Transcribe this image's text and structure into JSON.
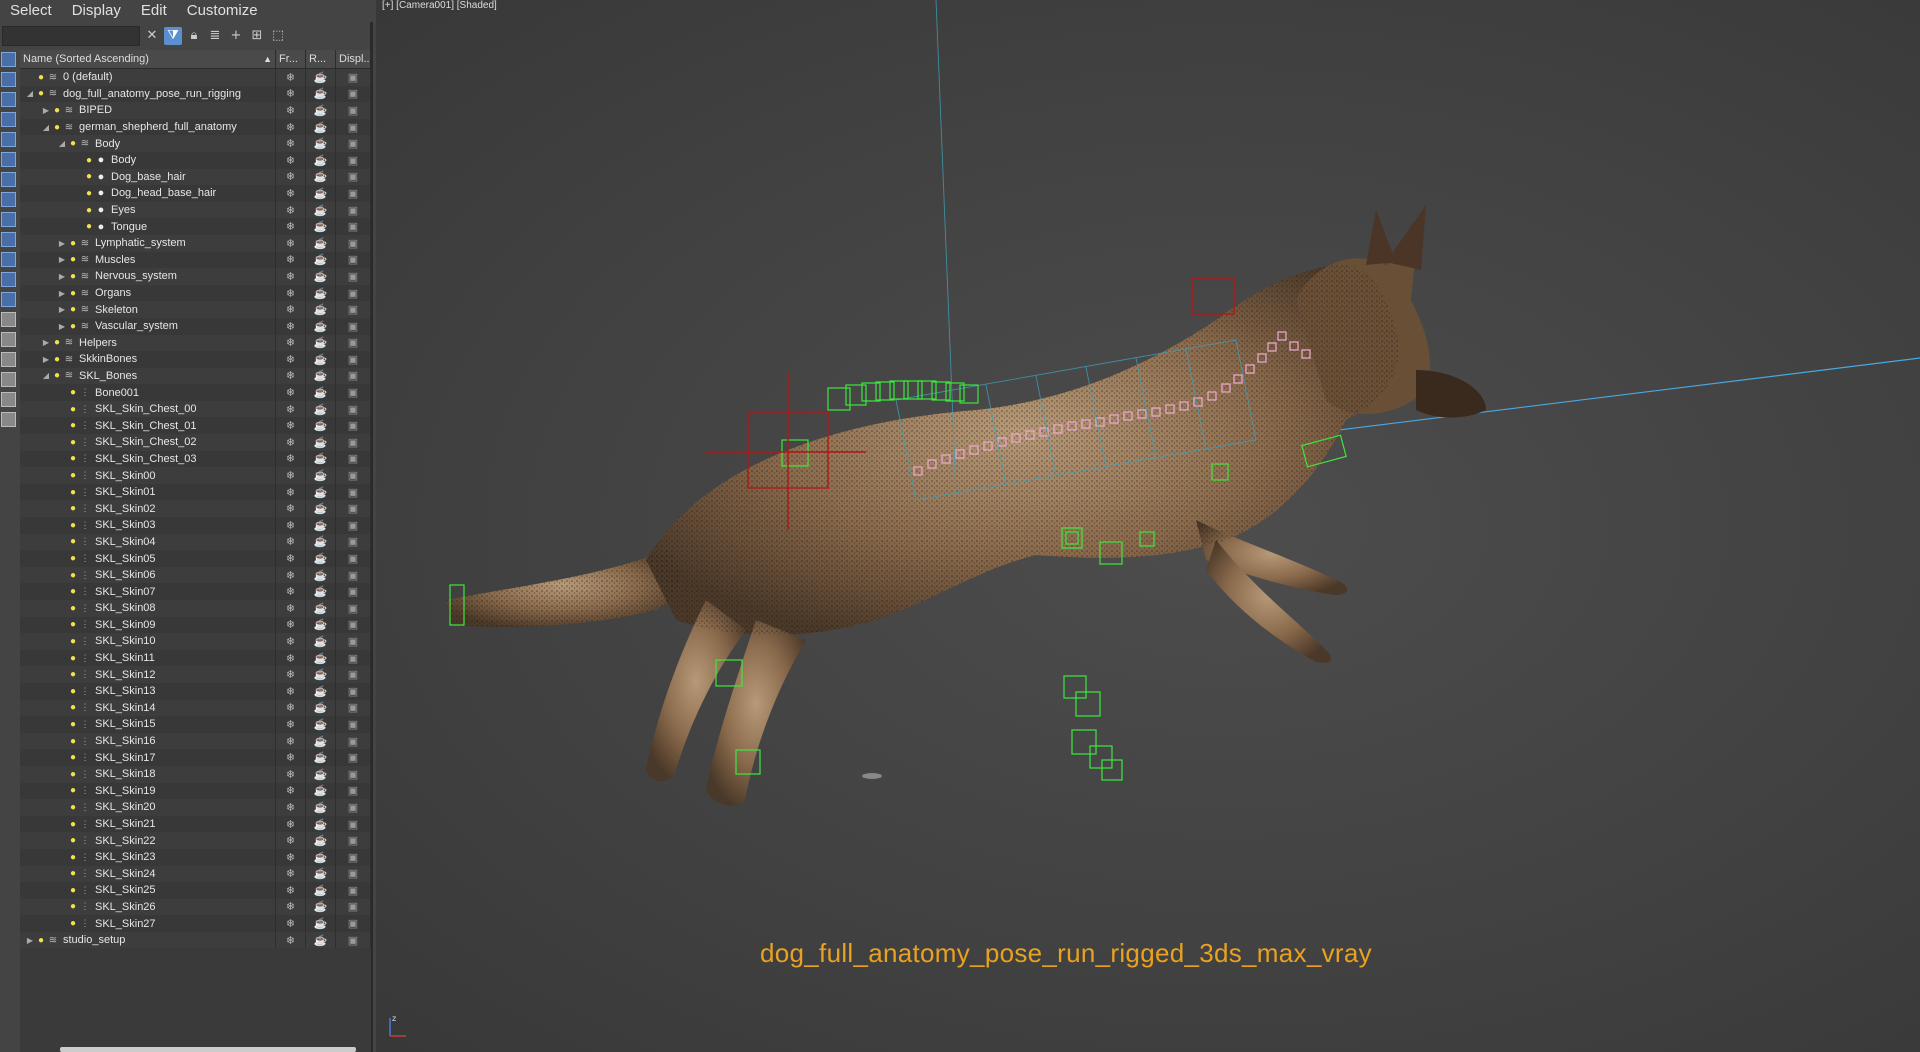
{
  "menu": {
    "items": [
      "Select",
      "Display",
      "Edit",
      "Customize"
    ]
  },
  "toolbar": {
    "search_value": "",
    "buttons": [
      "close-icon",
      "filter-icon",
      "lock-icon",
      "layer-icon",
      "add-icon",
      "hierarchy-icon",
      "select-icon"
    ]
  },
  "explorer": {
    "columns": {
      "name": "Name (Sorted Ascending)",
      "frozen": "Fr...",
      "render": "R...",
      "display": "Displ..."
    },
    "rows": [
      {
        "label": "0 (default)",
        "indent": 0,
        "kind": "layer",
        "expander": ""
      },
      {
        "label": "dog_full_anatomy_pose_run_rigging",
        "indent": 0,
        "kind": "layer",
        "expander": "open"
      },
      {
        "label": "BIPED",
        "indent": 1,
        "kind": "layer",
        "expander": "closed"
      },
      {
        "label": "german_shepherd_full_anatomy",
        "indent": 1,
        "kind": "layer",
        "expander": "open"
      },
      {
        "label": "Body",
        "indent": 2,
        "kind": "layer",
        "expander": "open"
      },
      {
        "label": "Body",
        "indent": 3,
        "kind": "object",
        "expander": ""
      },
      {
        "label": "Dog_base_hair",
        "indent": 3,
        "kind": "object",
        "expander": ""
      },
      {
        "label": "Dog_head_base_hair",
        "indent": 3,
        "kind": "object",
        "expander": ""
      },
      {
        "label": "Eyes",
        "indent": 3,
        "kind": "object",
        "expander": ""
      },
      {
        "label": "Tongue",
        "indent": 3,
        "kind": "object",
        "expander": ""
      },
      {
        "label": "Lymphatic_system",
        "indent": 2,
        "kind": "layer",
        "expander": "closed"
      },
      {
        "label": "Muscles",
        "indent": 2,
        "kind": "layer",
        "expander": "closed"
      },
      {
        "label": "Nervous_system",
        "indent": 2,
        "kind": "layer",
        "expander": "closed"
      },
      {
        "label": "Organs",
        "indent": 2,
        "kind": "layer",
        "expander": "closed"
      },
      {
        "label": "Skeleton",
        "indent": 2,
        "kind": "layer",
        "expander": "closed"
      },
      {
        "label": "Vascular_system",
        "indent": 2,
        "kind": "layer",
        "expander": "closed"
      },
      {
        "label": "Helpers",
        "indent": 1,
        "kind": "layer",
        "expander": "closed"
      },
      {
        "label": "SkkinBones",
        "indent": 1,
        "kind": "layer",
        "expander": "closed"
      },
      {
        "label": "SKL_Bones",
        "indent": 1,
        "kind": "layer",
        "expander": "open"
      },
      {
        "label": "Bone001",
        "indent": 2,
        "kind": "bone",
        "expander": ""
      },
      {
        "label": "SKL_Skin_Chest_00",
        "indent": 2,
        "kind": "bone",
        "expander": ""
      },
      {
        "label": "SKL_Skin_Chest_01",
        "indent": 2,
        "kind": "bone",
        "expander": ""
      },
      {
        "label": "SKL_Skin_Chest_02",
        "indent": 2,
        "kind": "bone",
        "expander": ""
      },
      {
        "label": "SKL_Skin_Chest_03",
        "indent": 2,
        "kind": "bone",
        "expander": ""
      },
      {
        "label": "SKL_Skin00",
        "indent": 2,
        "kind": "bone",
        "expander": ""
      },
      {
        "label": "SKL_Skin01",
        "indent": 2,
        "kind": "bone",
        "expander": ""
      },
      {
        "label": "SKL_Skin02",
        "indent": 2,
        "kind": "bone",
        "expander": ""
      },
      {
        "label": "SKL_Skin03",
        "indent": 2,
        "kind": "bone",
        "expander": ""
      },
      {
        "label": "SKL_Skin04",
        "indent": 2,
        "kind": "bone",
        "expander": ""
      },
      {
        "label": "SKL_Skin05",
        "indent": 2,
        "kind": "bone",
        "expander": ""
      },
      {
        "label": "SKL_Skin06",
        "indent": 2,
        "kind": "bone",
        "expander": ""
      },
      {
        "label": "SKL_Skin07",
        "indent": 2,
        "kind": "bone",
        "expander": ""
      },
      {
        "label": "SKL_Skin08",
        "indent": 2,
        "kind": "bone",
        "expander": ""
      },
      {
        "label": "SKL_Skin09",
        "indent": 2,
        "kind": "bone",
        "expander": ""
      },
      {
        "label": "SKL_Skin10",
        "indent": 2,
        "kind": "bone",
        "expander": ""
      },
      {
        "label": "SKL_Skin11",
        "indent": 2,
        "kind": "bone",
        "expander": ""
      },
      {
        "label": "SKL_Skin12",
        "indent": 2,
        "kind": "bone",
        "expander": ""
      },
      {
        "label": "SKL_Skin13",
        "indent": 2,
        "kind": "bone",
        "expander": ""
      },
      {
        "label": "SKL_Skin14",
        "indent": 2,
        "kind": "bone",
        "expander": ""
      },
      {
        "label": "SKL_Skin15",
        "indent": 2,
        "kind": "bone",
        "expander": ""
      },
      {
        "label": "SKL_Skin16",
        "indent": 2,
        "kind": "bone",
        "expander": ""
      },
      {
        "label": "SKL_Skin17",
        "indent": 2,
        "kind": "bone",
        "expander": ""
      },
      {
        "label": "SKL_Skin18",
        "indent": 2,
        "kind": "bone",
        "expander": ""
      },
      {
        "label": "SKL_Skin19",
        "indent": 2,
        "kind": "bone",
        "expander": ""
      },
      {
        "label": "SKL_Skin20",
        "indent": 2,
        "kind": "bone",
        "expander": ""
      },
      {
        "label": "SKL_Skin21",
        "indent": 2,
        "kind": "bone",
        "expander": ""
      },
      {
        "label": "SKL_Skin22",
        "indent": 2,
        "kind": "bone",
        "expander": ""
      },
      {
        "label": "SKL_Skin23",
        "indent": 2,
        "kind": "bone",
        "expander": ""
      },
      {
        "label": "SKL_Skin24",
        "indent": 2,
        "kind": "bone",
        "expander": ""
      },
      {
        "label": "SKL_Skin25",
        "indent": 2,
        "kind": "bone",
        "expander": ""
      },
      {
        "label": "SKL_Skin26",
        "indent": 2,
        "kind": "bone",
        "expander": ""
      },
      {
        "label": "SKL_Skin27",
        "indent": 2,
        "kind": "bone",
        "expander": ""
      },
      {
        "label": "studio_setup",
        "indent": 0,
        "kind": "layer",
        "expander": "closed"
      }
    ]
  },
  "viewport": {
    "label": "[+] [Camera001] [Shaded]",
    "caption": "dog_full_anatomy_pose_run_rigged_3ds_max_vray",
    "caption_color": "#e9a21f"
  }
}
